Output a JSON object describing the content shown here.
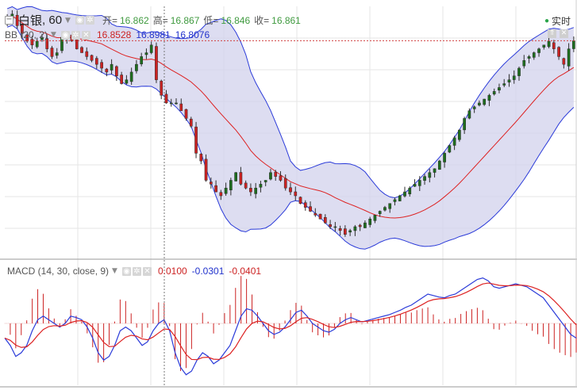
{
  "header": {
    "symbol": "白银",
    "interval": "60",
    "open_label": "开=",
    "open_value": "16.862",
    "high_label": "高=",
    "high_value": "16.867",
    "low_label": "低=",
    "low_value": "16.846",
    "close_label": "收=",
    "close_value": "16.861",
    "realtime_label": "实时"
  },
  "bb_legend": {
    "label": "BB (20, 2)",
    "mid": "16.8528",
    "upper": "16.8981",
    "lower": "16.8076"
  },
  "macd_legend": {
    "label": "MACD (14, 30, close, 9)",
    "hist": "0.0100",
    "macd": "-0.0301",
    "signal": "-0.0401"
  },
  "colors": {
    "candle_up": "#1e6e1e",
    "candle_down": "#cc2222",
    "bb_band_fill": "#d2d2ec",
    "bb_band_line": "#2b3bd9",
    "bb_mid": "#dd2222",
    "macd_line": "#2b3bd9",
    "signal_line": "#dd2222",
    "histogram": "#cc2222",
    "grid": "#e6e6e6",
    "crosshair": "#777777",
    "price_line": "#d04040"
  },
  "chart_data": [
    {
      "type": "candlestick",
      "title": "白银, 60",
      "y_range": [
        16.3,
        16.95
      ],
      "current_price": 16.861,
      "bollinger": {
        "period": 20,
        "std": 2
      },
      "close": [
        16.92,
        16.93,
        16.9,
        16.88,
        16.86,
        16.85,
        16.86,
        16.87,
        16.84,
        16.82,
        16.83,
        16.87,
        16.88,
        16.86,
        16.84,
        16.83,
        16.82,
        16.81,
        16.8,
        16.79,
        16.78,
        16.8,
        16.77,
        16.75,
        16.76,
        16.78,
        16.8,
        16.82,
        16.83,
        16.85,
        16.76,
        16.72,
        16.7,
        16.7,
        16.7,
        16.68,
        16.66,
        16.64,
        16.57,
        16.55,
        16.5,
        16.49,
        16.47,
        16.46,
        16.48,
        16.5,
        16.52,
        16.49,
        16.48,
        16.47,
        16.48,
        16.49,
        16.5,
        16.52,
        16.51,
        16.5,
        16.48,
        16.47,
        16.46,
        16.44,
        16.43,
        16.42,
        16.41,
        16.4,
        16.39,
        16.38,
        16.38,
        16.37,
        16.36,
        16.37,
        16.38,
        16.38,
        16.39,
        16.4,
        16.41,
        16.42,
        16.43,
        16.44,
        16.45,
        16.46,
        16.47,
        16.48,
        16.49,
        16.5,
        16.51,
        16.52,
        16.53,
        16.55,
        16.57,
        16.59,
        16.61,
        16.63,
        16.66,
        16.68,
        16.69,
        16.7,
        16.71,
        16.72,
        16.73,
        16.74,
        16.75,
        16.76,
        16.77,
        16.79,
        16.81,
        16.82,
        16.83,
        16.84,
        16.85,
        16.86,
        16.84,
        16.82,
        16.8,
        16.84,
        16.861
      ],
      "macd": {
        "hist": 0.01,
        "macd": -0.0301,
        "signal": -0.0401,
        "params": "14, 30, close, 9",
        "macd_series": [
          -0.02,
          -0.03,
          -0.045,
          -0.04,
          -0.03,
          -0.01,
          0.005,
          0.01,
          0.005,
          0.0,
          -0.005,
          0.0,
          0.01,
          0.008,
          0.005,
          -0.005,
          -0.02,
          -0.04,
          -0.05,
          -0.045,
          -0.03,
          -0.01,
          -0.005,
          -0.01,
          -0.02,
          -0.03,
          -0.025,
          -0.01,
          0.0,
          0.005,
          -0.01,
          -0.04,
          -0.06,
          -0.07,
          -0.065,
          -0.05,
          -0.04,
          -0.045,
          -0.055,
          -0.05,
          -0.04,
          -0.03,
          -0.01,
          0.01,
          0.02,
          0.018,
          0.01,
          0.0,
          -0.01,
          -0.015,
          -0.012,
          -0.005,
          0.005,
          0.015,
          0.018,
          0.01,
          0.0,
          -0.005,
          -0.01,
          -0.012,
          -0.008,
          0.0,
          0.005,
          0.008,
          0.005,
          0.002,
          0.004,
          0.006,
          0.008,
          0.01,
          0.012,
          0.015,
          0.018,
          0.022,
          0.025,
          0.03,
          0.035,
          0.04,
          0.038,
          0.036,
          0.035,
          0.038,
          0.04,
          0.045,
          0.05,
          0.055,
          0.06,
          0.062,
          0.058,
          0.05,
          0.048,
          0.05,
          0.052,
          0.054,
          0.052,
          0.05,
          0.045,
          0.04,
          0.035,
          0.025,
          0.015,
          0.005,
          -0.005,
          -0.015,
          -0.02
        ]
      }
    }
  ]
}
